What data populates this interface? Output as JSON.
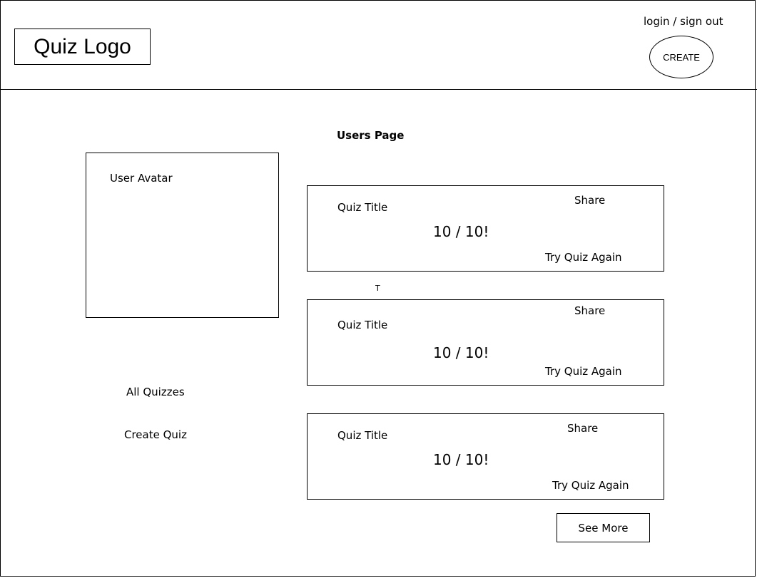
{
  "header": {
    "logo_text": "Quiz Logo",
    "auth_link": "login / sign out",
    "create_button": "CREATE"
  },
  "page": {
    "title": "Users Page",
    "avatar_label": "User Avatar",
    "stray_text": "T"
  },
  "sidebar": {
    "items": [
      {
        "label": "All Quizzes"
      },
      {
        "label": "Create Quiz"
      }
    ]
  },
  "quizzes": [
    {
      "title": "Quiz Title",
      "score": "10 / 10!",
      "share": "Share",
      "retry": "Try Quiz Again"
    },
    {
      "title": "Quiz Title",
      "score": "10 / 10!",
      "share": "Share",
      "retry": "Try Quiz Again"
    },
    {
      "title": "Quiz Title",
      "score": "10 / 10!",
      "share": "Share",
      "retry": "Try Quiz Again"
    }
  ],
  "footer": {
    "see_more": "See More"
  }
}
